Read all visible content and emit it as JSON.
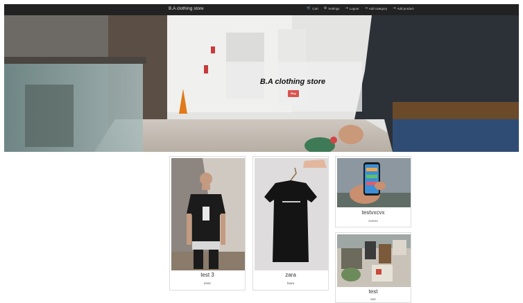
{
  "navbar": {
    "brand": "B.A clothing store",
    "links": [
      {
        "icon": "cart-icon",
        "glyph": "🛒",
        "label": "Cart"
      },
      {
        "icon": "gear-icon",
        "glyph": "⚙",
        "label": "Settings"
      },
      {
        "icon": "logout-icon",
        "glyph": "⇥",
        "label": "Logout"
      },
      {
        "icon": "add-category-icon",
        "glyph": "⇥",
        "label": "Add category"
      },
      {
        "icon": "add-product-icon",
        "glyph": "⇥",
        "label": "Add product"
      }
    ]
  },
  "hero": {
    "title": "B.A clothing store",
    "buy_label": "Buy"
  },
  "products": [
    {
      "title": "test 3",
      "description": "test2"
    },
    {
      "title": "zara",
      "description": "biara"
    },
    {
      "title": "testvxcvx",
      "description": "xvxvxv"
    },
    {
      "title": "test",
      "description": "test"
    }
  ],
  "colors": {
    "navbar": "#222222",
    "buy_button": "#d9534f"
  }
}
